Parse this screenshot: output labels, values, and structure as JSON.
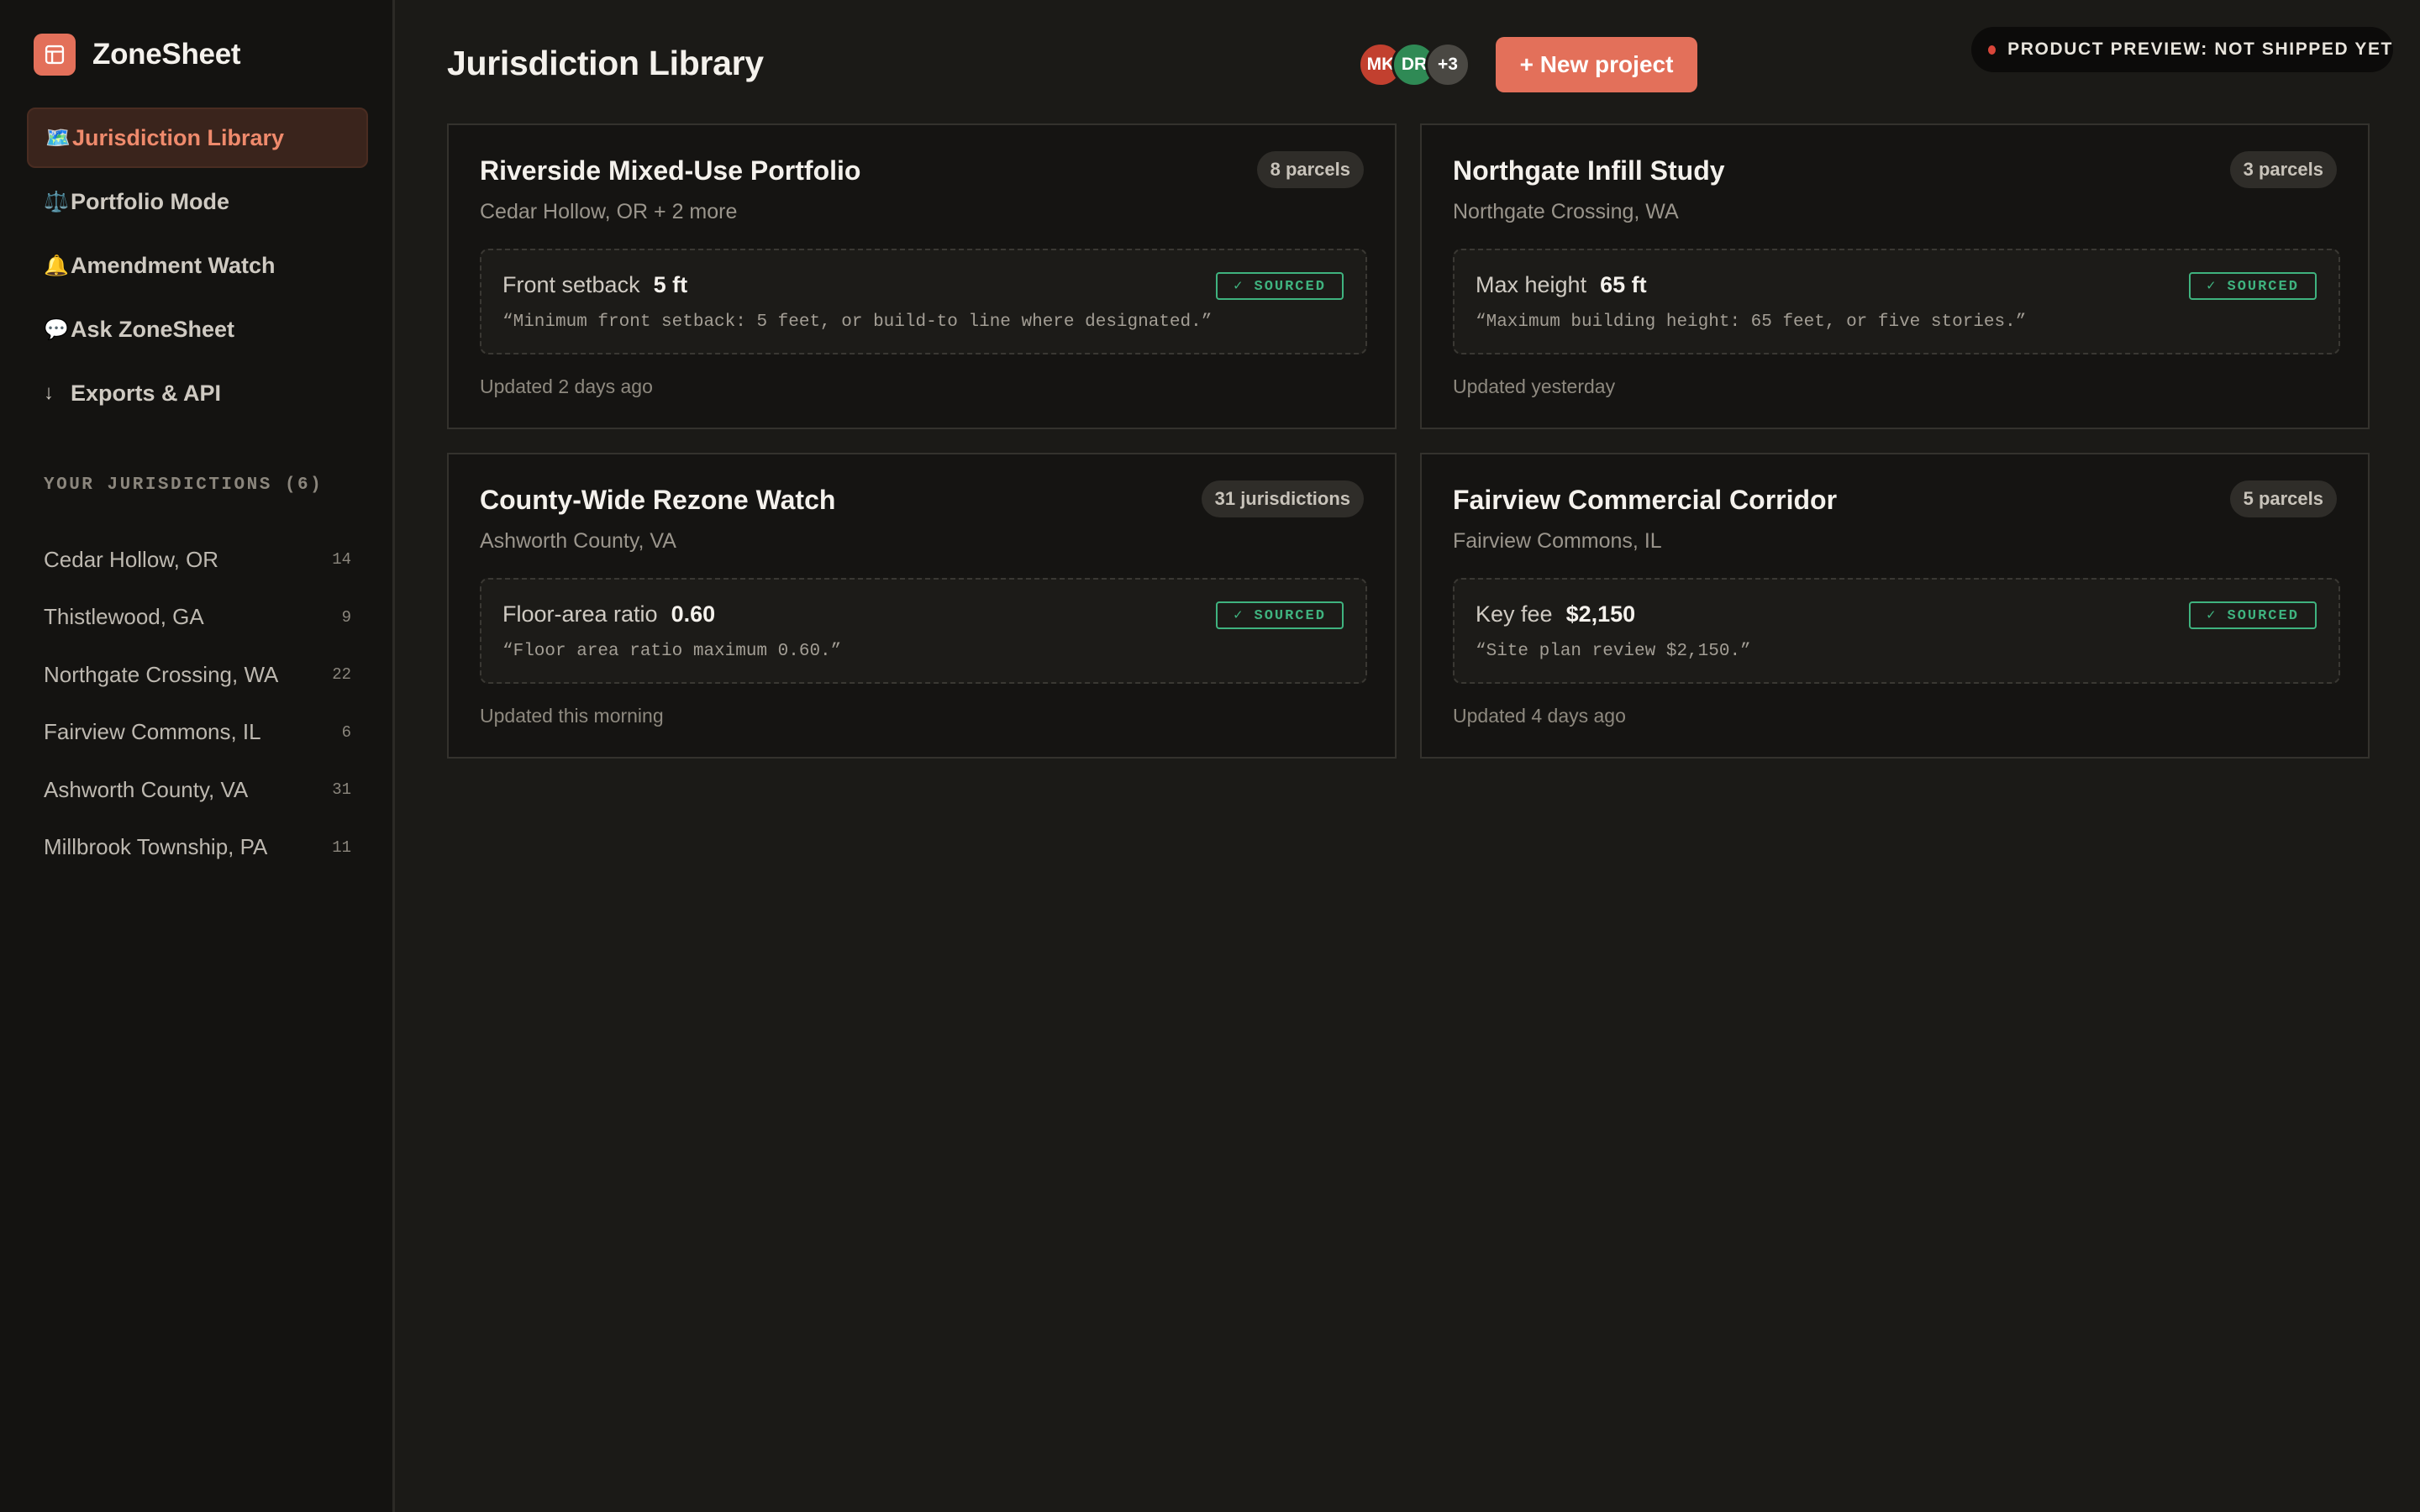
{
  "app": {
    "name": "ZoneSheet",
    "accent": "#e3705a",
    "background": "#1b1a17"
  },
  "sidebar": {
    "nav": [
      {
        "icon": "🗺️",
        "icon_name": "map-icon",
        "label": "Jurisdiction Library",
        "active": true
      },
      {
        "icon": "⚖️",
        "icon_name": "scales-icon",
        "label": "Portfolio Mode",
        "active": false
      },
      {
        "icon": "🔔",
        "icon_name": "bell-icon",
        "label": "Amendment Watch",
        "active": false
      },
      {
        "icon": "💬",
        "icon_name": "speech-bubble-icon",
        "label": "Ask ZoneSheet",
        "active": false
      },
      {
        "icon": "↓",
        "icon_name": "download-arrow-icon",
        "label": "Exports & API",
        "active": false
      }
    ],
    "section_title": "YOUR JURISDICTIONS (6)",
    "jurisdictions": [
      {
        "name": "Cedar Hollow, OR",
        "count": "14"
      },
      {
        "name": "Thistlewood, GA",
        "count": "9"
      },
      {
        "name": "Northgate Crossing, WA",
        "count": "22"
      },
      {
        "name": "Fairview Commons, IL",
        "count": "6"
      },
      {
        "name": "Ashworth County, VA",
        "count": "31"
      },
      {
        "name": "Millbrook Township, PA",
        "count": "11"
      }
    ]
  },
  "header": {
    "title": "Jurisdiction Library",
    "avatars": [
      {
        "initials": "MK",
        "color": "#c2402f"
      },
      {
        "initials": "DR",
        "color": "#2f8a55"
      },
      {
        "initials": "+3",
        "color": "#4a4843"
      }
    ],
    "new_project_label": "+ New project",
    "preview_badge": "PRODUCT PREVIEW: NOT SHIPPED YET",
    "preview_dot_color": "#d9463a"
  },
  "projects": [
    {
      "title": "Riverside Mixed-Use Portfolio",
      "location": "Cedar Hollow, OR + 2 more",
      "badge": "8 parcels",
      "fact_label": "Front setback",
      "fact_value": "5 ft",
      "status": "✓ SOURCED",
      "quote": "“Minimum front setback: 5 feet, or build-to line where designated.”",
      "updated": "Updated 2 days ago"
    },
    {
      "title": "Northgate Infill Study",
      "location": "Northgate Crossing, WA",
      "badge": "3 parcels",
      "fact_label": "Max height",
      "fact_value": "65 ft",
      "status": "✓ SOURCED",
      "quote": "“Maximum building height: 65 feet, or five stories.”",
      "updated": "Updated yesterday"
    },
    {
      "title": "County-Wide Rezone Watch",
      "location": "Ashworth County, VA",
      "badge": "31 jurisdictions",
      "fact_label": "Floor-area ratio",
      "fact_value": "0.60",
      "status": "✓ SOURCED",
      "quote": "“Floor area ratio maximum 0.60.”",
      "updated": "Updated this morning"
    },
    {
      "title": "Fairview Commercial Corridor",
      "location": "Fairview Commons, IL",
      "badge": "5 parcels",
      "fact_label": "Key fee",
      "fact_value": "$2,150",
      "status": "✓ SOURCED",
      "quote": "“Site plan review $2,150.”",
      "updated": "Updated 4 days ago"
    }
  ]
}
